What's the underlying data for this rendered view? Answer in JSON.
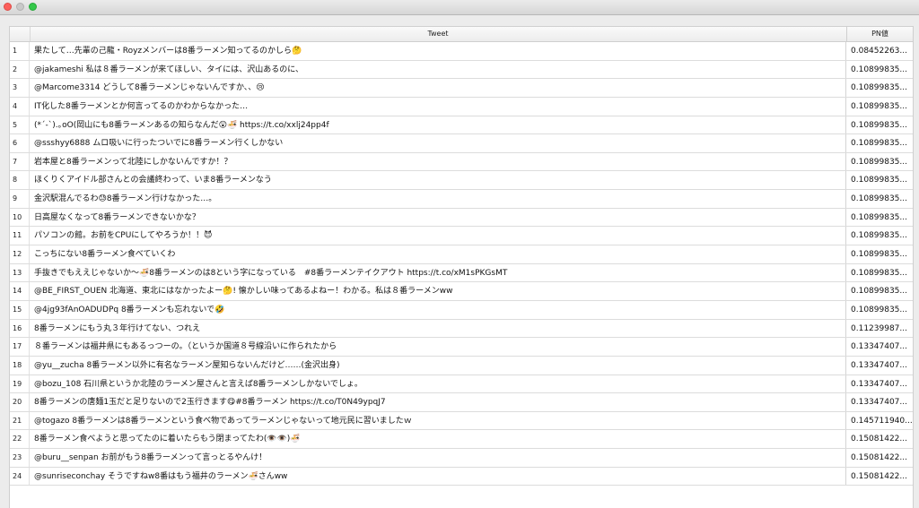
{
  "window": {
    "controls": [
      "close",
      "minimize",
      "maximize"
    ]
  },
  "table": {
    "columns": {
      "tweet": "Tweet",
      "pn": "PN値"
    },
    "rows": [
      {
        "num": "1",
        "tweet": "果たして…先輩の己龍・Royzメンバーは8番ラーメン知ってるのかしら🤔",
        "pn": "0.08452263..."
      },
      {
        "num": "2",
        "tweet": "@jakameshi 私は８番ラーメンが来てほしい、タイには、沢山あるのに、",
        "pn": "0.10899835..."
      },
      {
        "num": "3",
        "tweet": "@Marcome3314 どうして8番ラーメンじゃないんですか、、😢",
        "pn": "0.10899835..."
      },
      {
        "num": "4",
        "tweet": "IT化した8番ラーメンとか何言ってるのかわからなかった…",
        "pn": "0.10899835..."
      },
      {
        "num": "5",
        "tweet": "(*´-`).｡oO(岡山にも8番ラーメンあるの知らなんだ😲🍜 https://t.co/xxlj24pp4f",
        "pn": "0.10899835..."
      },
      {
        "num": "6",
        "tweet": "@ssshyy6888 ムロ吸いに行ったついでに8番ラーメン行くしかない",
        "pn": "0.10899835..."
      },
      {
        "num": "7",
        "tweet": "岩本屋と8番ラーメンって北陸にしかないんですか！？",
        "pn": "0.10899835..."
      },
      {
        "num": "8",
        "tweet": "ほくりくアイドル部さんとの会議終わって、いま8番ラーメンなう",
        "pn": "0.10899835..."
      },
      {
        "num": "9",
        "tweet": "金沢駅混んでるわ😓8番ラーメン行けなかった…。",
        "pn": "0.10899835..."
      },
      {
        "num": "10",
        "tweet": "日高屋なくなって8番ラーメンできないかな？",
        "pn": "0.10899835..."
      },
      {
        "num": "11",
        "tweet": "パソコンの館。お前をCPUにしてやろうか！！😈",
        "pn": "0.10899835..."
      },
      {
        "num": "12",
        "tweet": "こっちにない8番ラーメン食べていくわ",
        "pn": "0.10899835..."
      },
      {
        "num": "13",
        "tweet": "手抜きでもええじゃないか〜🍜8番ラーメンのは8という字になっている　#8番ラーメンテイクアウト https://t.co/xM1sPKGsMT",
        "pn": "0.10899835..."
      },
      {
        "num": "14",
        "tweet": "@BE_FIRST_OUEN 北海道、東北にはなかったよー🤔! 懐かしい味ってあるよねー！わかる。私は８番ラーメンww",
        "pn": "0.10899835..."
      },
      {
        "num": "15",
        "tweet": "@4jg93fAnOADUDPq 8番ラーメンも忘れないで🤣",
        "pn": "0.10899835..."
      },
      {
        "num": "16",
        "tweet": "8番ラーメンにもう丸３年行けてない、つれえ",
        "pn": "0.11239987..."
      },
      {
        "num": "17",
        "tweet": "８番ラーメンは福井県にもあるっつーの。（というか国道８号線沿いに作られたから",
        "pn": "0.13347407..."
      },
      {
        "num": "18",
        "tweet": "@yu__zucha 8番ラーメン以外に有名なラーメン屋知らないんだけど……(金沢出身)",
        "pn": "0.13347407..."
      },
      {
        "num": "19",
        "tweet": "@bozu_108 石川県というか北陸のラーメン屋さんと言えば8番ラーメンしかないでしょ。",
        "pn": "0.13347407..."
      },
      {
        "num": "20",
        "tweet": "8番ラーメンの唐麺1玉だと足りないので2玉行きます😋#8番ラーメン https://t.co/T0N49ypqJ7",
        "pn": "0.13347407..."
      },
      {
        "num": "21",
        "tweet": "@togazo 8番ラーメンは8番ラーメンという食べ物であってラーメンじゃないって地元民に習いましたｗ",
        "pn": "0.145711940..."
      },
      {
        "num": "22",
        "tweet": "8番ラーメン食べようと思ってたのに着いたらもう閉まってたわ(👁️👁️)🍜",
        "pn": "0.15081422..."
      },
      {
        "num": "23",
        "tweet": "@buru__senpan お前がもう8番ラーメンって言っとるやんけ！",
        "pn": "0.15081422..."
      },
      {
        "num": "24",
        "tweet": "@sunriseconchay そうですねw8番はもう福井のラーメン🍜さんww",
        "pn": "0.15081422..."
      }
    ]
  }
}
